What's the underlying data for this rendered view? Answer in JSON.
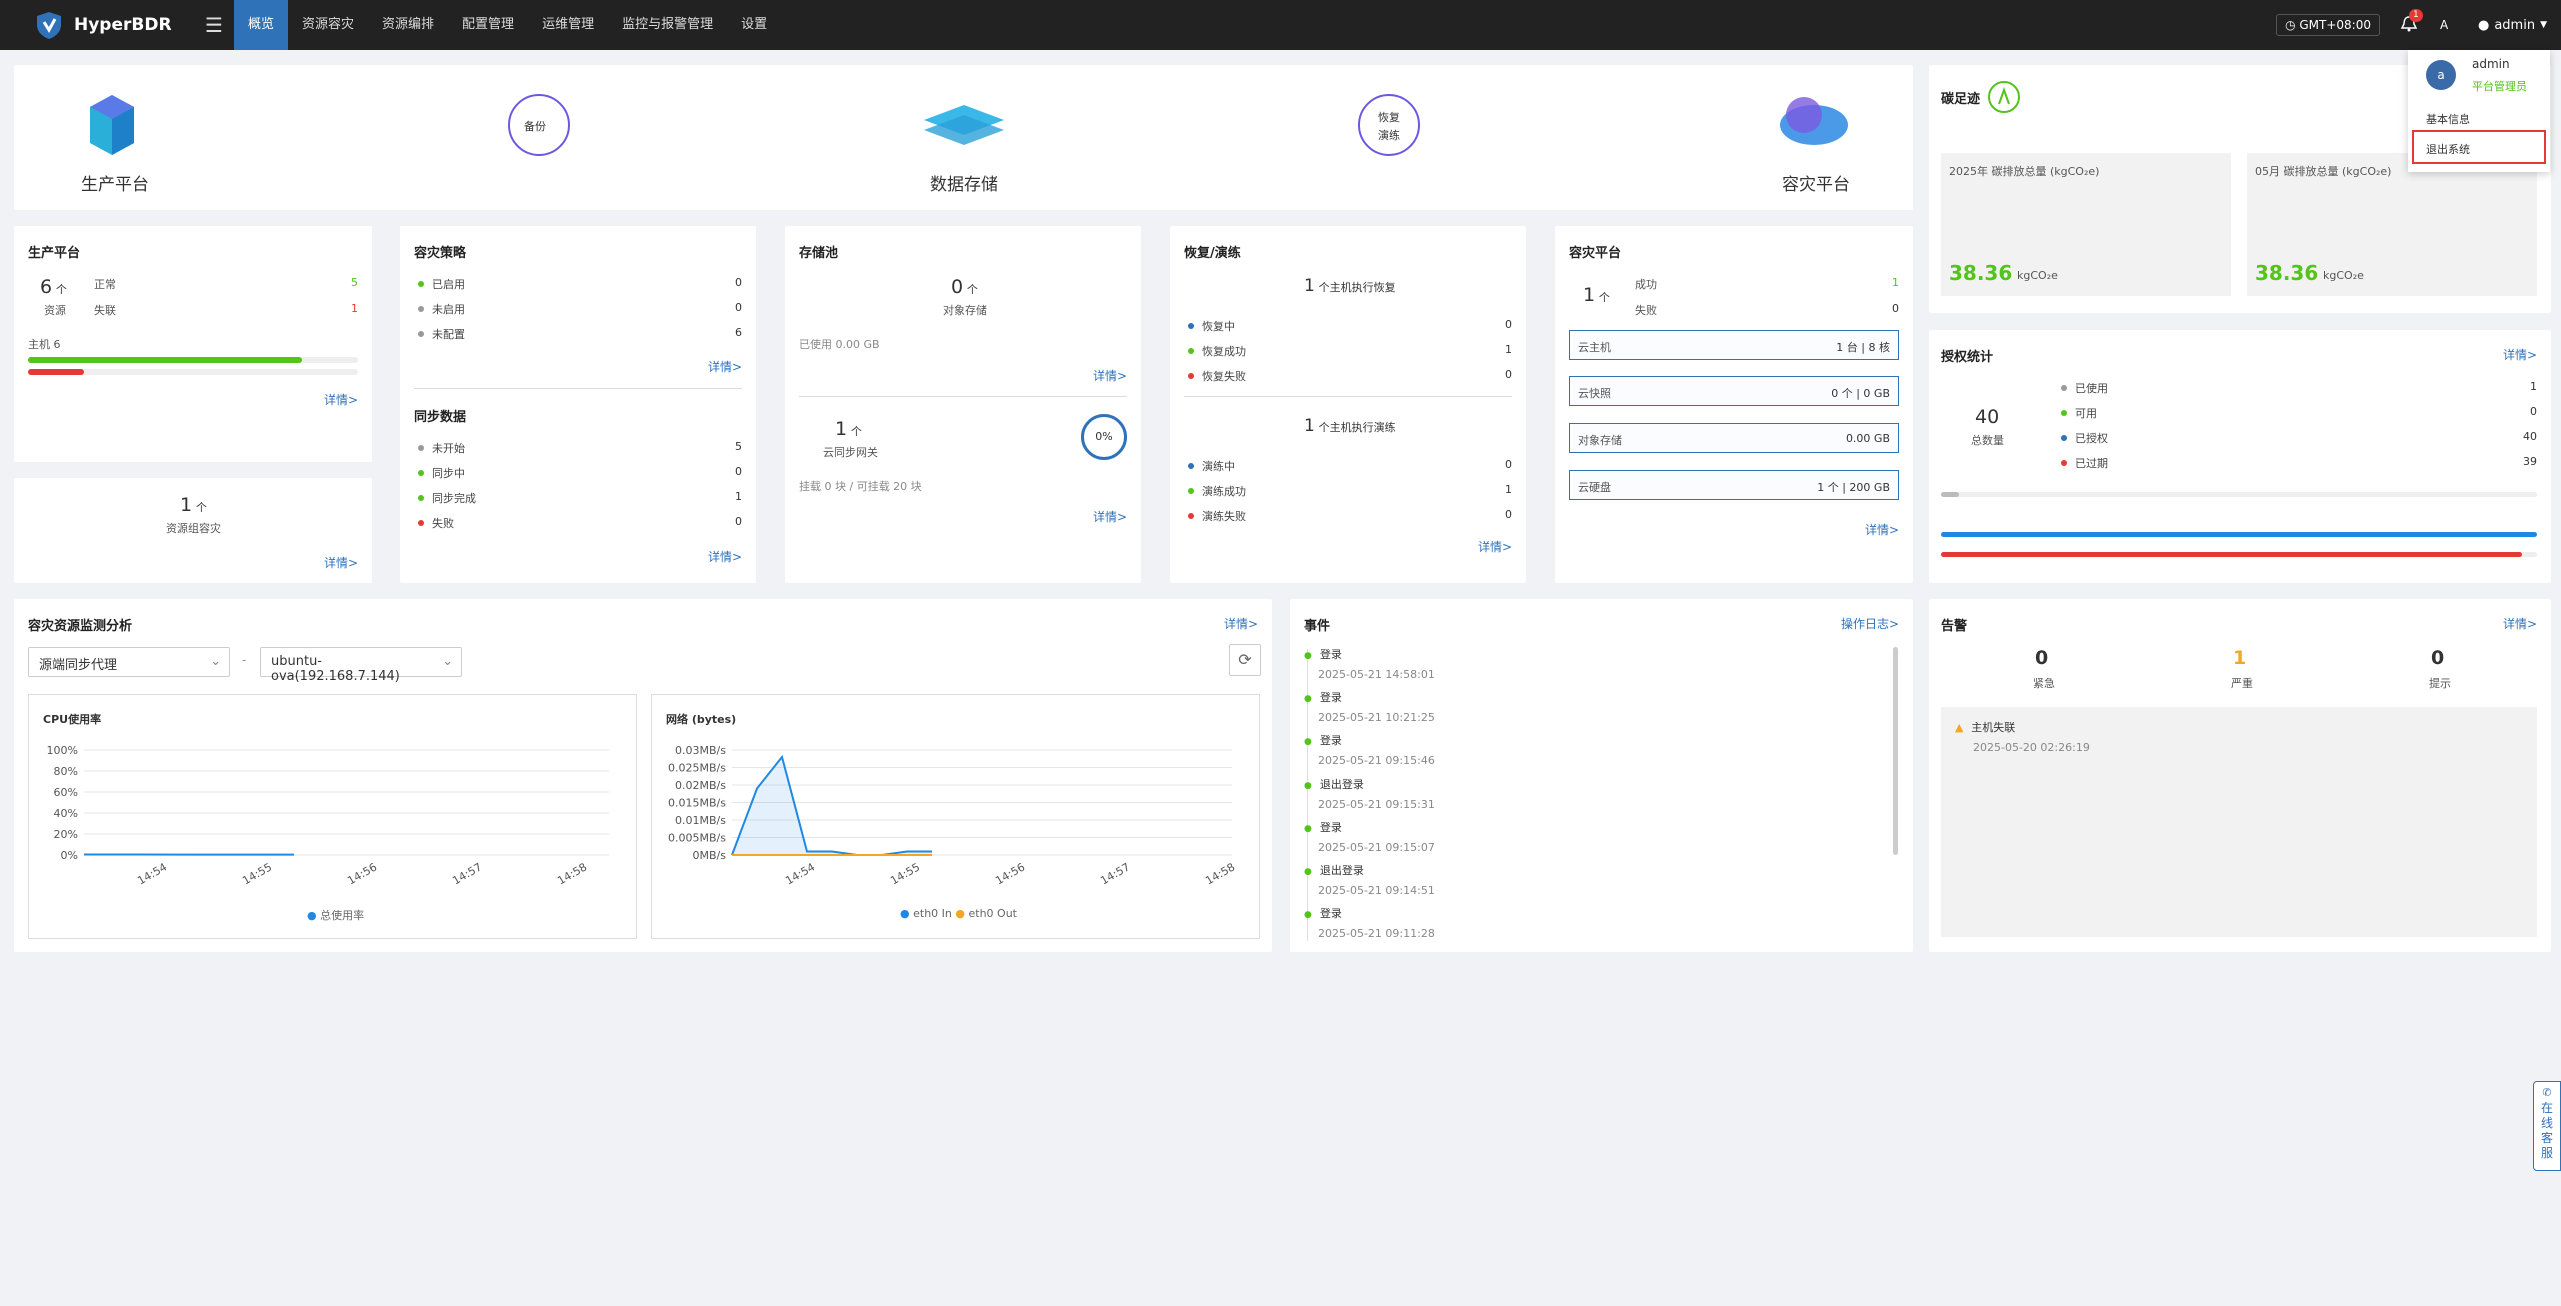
{
  "nav": {
    "brand": "HyperBDR",
    "items": [
      "概览",
      "资源容灾",
      "资源编排",
      "配置管理",
      "运维管理",
      "监控与报警管理",
      "设置"
    ],
    "timezone": "GMT+08:00",
    "alert_count": "1",
    "user": "admin"
  },
  "user_menu": {
    "name": "admin",
    "avatar_letter": "a",
    "role": "平台管理员",
    "basic_info": "基本信息",
    "logout": "退出系统"
  },
  "flow": {
    "source": "生产平台",
    "storage": "数据存储",
    "target": "容灾平台",
    "step1": "备份",
    "step2a": "恢复",
    "step2b": "演练"
  },
  "carbon": {
    "title": "碳足迹",
    "annual_label": "2025年 碳排放总量 (kgCO₂e)",
    "annual_value": "38.36",
    "monthly_label": "05月 碳排放总量 (kgCO₂e)",
    "monthly_value": "38.36",
    "unit": "kgCO₂e"
  },
  "prod": {
    "title": "生产平台",
    "count": "6",
    "unit": "个",
    "sub": "资源",
    "normal_label": "正常",
    "normal_value": "5",
    "lost_label": "失联",
    "lost_value": "1",
    "hosts": "主机  6",
    "detail": "详情>",
    "progress_green": 0.83,
    "progress_red": 0.17
  },
  "group": {
    "count": "1",
    "unit": "个",
    "label": "资源组容灾",
    "detail": "详情>"
  },
  "policy": {
    "title": "容灾策略",
    "items": [
      {
        "label": "已启用",
        "value": "0",
        "color": "#52c41a"
      },
      {
        "label": "未启用",
        "value": "0",
        "color": "#999"
      },
      {
        "label": "未配置",
        "value": "6",
        "color": "#999"
      }
    ],
    "detail": "详情>"
  },
  "sync": {
    "title": "同步数据",
    "items": [
      {
        "label": "未开始",
        "value": "5",
        "color": "#999"
      },
      {
        "label": "同步中",
        "value": "0",
        "color": "#52c41a"
      },
      {
        "label": "同步完成",
        "value": "1",
        "color": "#52c41a"
      },
      {
        "label": "失败",
        "value": "0",
        "color": "#e53935"
      }
    ],
    "detail": "详情>"
  },
  "storage": {
    "title": "存储池",
    "obj_count": "0",
    "obj_unit": "个",
    "obj_label": "对象存储",
    "used": "已使用 0.00 GB",
    "detail1": "详情>",
    "gw_count": "1",
    "gw_unit": "个",
    "gw_label": "云同步网关",
    "percent": "0%",
    "mount": "挂载 0 块 / 可挂载 20 块",
    "detail2": "详情>"
  },
  "recover": {
    "title": "恢复/演练",
    "rec_head_num": "1",
    "rec_head": "个主机执行恢复",
    "rec_items": [
      {
        "label": "恢复中",
        "value": "0",
        "color": "#2f72b8"
      },
      {
        "label": "恢复成功",
        "value": "1",
        "color": "#52c41a"
      },
      {
        "label": "恢复失败",
        "value": "0",
        "color": "#e53935"
      }
    ],
    "dr_head_num": "1",
    "dr_head": "个主机执行演练",
    "dr_items": [
      {
        "label": "演练中",
        "value": "0",
        "color": "#2f72b8"
      },
      {
        "label": "演练成功",
        "value": "1",
        "color": "#52c41a"
      },
      {
        "label": "演练失败",
        "value": "0",
        "color": "#e53935"
      }
    ],
    "detail": "详情>"
  },
  "drplat": {
    "title": "容灾平台",
    "count": "1",
    "unit": "个",
    "success_label": "成功",
    "success_value": "1",
    "fail_label": "失败",
    "fail_value": "0",
    "rows": [
      {
        "label": "云主机",
        "value": "1 台  |  8 核"
      },
      {
        "label": "云快照",
        "value": "0 个  |  0 GB"
      },
      {
        "label": "对象存储",
        "value": "0.00 GB"
      },
      {
        "label": "云硬盘",
        "value": "1 个  |  200 GB"
      }
    ],
    "detail": "详情>"
  },
  "license": {
    "title": "授权统计",
    "detail": "详情>",
    "total": "40",
    "total_label": "总数量",
    "items": [
      {
        "label": "已使用",
        "value": "1",
        "color": "#999"
      },
      {
        "label": "可用",
        "value": "0",
        "color": "#52c41a"
      },
      {
        "label": "已授权",
        "value": "40",
        "color": "#2f72b8"
      },
      {
        "label": "已过期",
        "value": "39",
        "color": "#e53935"
      }
    ],
    "bar_used": 0.025,
    "bar_auth": 1.0,
    "bar_expired": 0.975
  },
  "monitor": {
    "title": "容灾资源监测分析",
    "detail": "详情>",
    "select1": "源端同步代理",
    "sep": "-",
    "select2": "ubuntu-ova(192.168.7.144)"
  },
  "cpu_chart": {
    "title": "CPU使用率",
    "legend": "总使用率",
    "yticks": [
      "100%",
      "80%",
      "60%",
      "40%",
      "20%",
      "0%"
    ],
    "xticks": [
      "14:54",
      "14:55",
      "14:56",
      "14:57",
      "14:58"
    ]
  },
  "net_chart": {
    "title": "网络 (bytes)",
    "legend_in": "eth0 In",
    "legend_out": "eth0 Out",
    "yticks": [
      "0.03MB/s",
      "0.025MB/s",
      "0.02MB/s",
      "0.015MB/s",
      "0.01MB/s",
      "0.005MB/s",
      "0MB/s"
    ],
    "xticks": [
      "14:54",
      "14:55",
      "14:56",
      "14:57",
      "14:58"
    ]
  },
  "chart_data": [
    {
      "type": "line",
      "title": "CPU使用率",
      "series": [
        {
          "name": "总使用率",
          "x": [
            "14:53:30",
            "14:54",
            "14:54:30",
            "14:55",
            "14:55:10"
          ],
          "values": [
            0.5,
            0.5,
            0.3,
            0.4,
            0.3
          ]
        }
      ],
      "ylim": [
        0,
        100
      ],
      "xticks": [
        "14:54",
        "14:55",
        "14:56",
        "14:57",
        "14:58"
      ]
    },
    {
      "type": "area",
      "title": "网络 (bytes)",
      "series": [
        {
          "name": "eth0 In",
          "values": [
            0,
            0.019,
            0.028,
            0.001,
            0.001,
            0,
            0,
            0.001,
            0.001
          ]
        },
        {
          "name": "eth0 Out",
          "values": [
            0,
            0,
            0,
            0,
            0,
            0,
            0,
            0,
            0
          ]
        }
      ],
      "ylim": [
        0,
        0.03
      ],
      "xticks": [
        "14:54",
        "14:55",
        "14:56",
        "14:57",
        "14:58"
      ]
    }
  ],
  "events": {
    "title": "事件",
    "link": "操作日志>",
    "items": [
      {
        "name": "登录",
        "time": "2025-05-21 14:58:01"
      },
      {
        "name": "登录",
        "time": "2025-05-21 10:21:25"
      },
      {
        "name": "登录",
        "time": "2025-05-21 09:15:46"
      },
      {
        "name": "退出登录",
        "time": "2025-05-21 09:15:31"
      },
      {
        "name": "登录",
        "time": "2025-05-21 09:15:07"
      },
      {
        "name": "退出登录",
        "time": "2025-05-21 09:14:51"
      },
      {
        "name": "登录",
        "time": "2025-05-21 09:11:28"
      }
    ]
  },
  "alarms": {
    "title": "告警",
    "detail": "详情>",
    "urgent": "0",
    "urgent_label": "紧急",
    "serious": "1",
    "serious_label": "严重",
    "hint": "0",
    "hint_label": "提示",
    "item_name": "主机失联",
    "item_time": "2025-05-20 02:26:19"
  },
  "service": {
    "label": "在线客服"
  }
}
